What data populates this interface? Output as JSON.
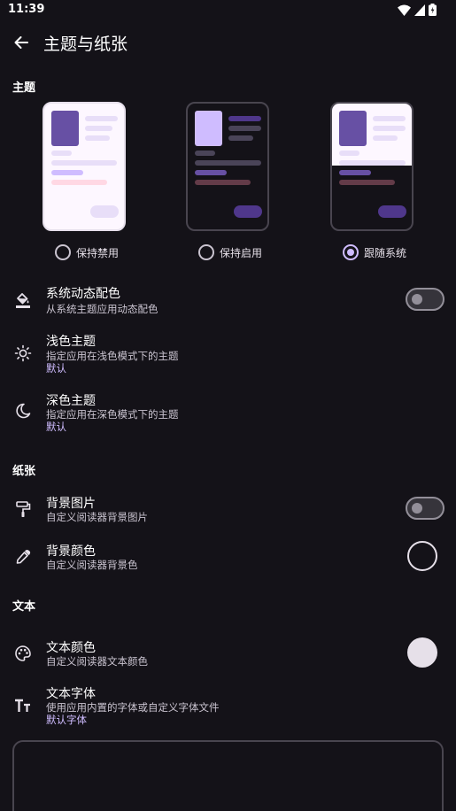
{
  "status": {
    "time": "11:39"
  },
  "header": {
    "title": "主题与纸张"
  },
  "sections": {
    "theme": "主题",
    "paper": "纸张",
    "text": "文本"
  },
  "theme_options": [
    {
      "label": "保持禁用",
      "selected": false
    },
    {
      "label": "保持启用",
      "selected": false
    },
    {
      "label": "跟随系统",
      "selected": true
    }
  ],
  "settings": {
    "dynamic_color": {
      "title": "系统动态配色",
      "subtitle": "从系统主题应用动态配色",
      "enabled": false
    },
    "light_theme": {
      "title": "浅色主题",
      "subtitle": "指定应用在浅色模式下的主题",
      "value": "默认"
    },
    "dark_theme": {
      "title": "深色主题",
      "subtitle": "指定应用在深色模式下的主题",
      "value": "默认"
    },
    "bg_image": {
      "title": "背景图片",
      "subtitle": "自定义阅读器背景图片",
      "enabled": false
    },
    "bg_color": {
      "title": "背景颜色",
      "subtitle": "自定义阅读器背景色",
      "color": "#141218"
    },
    "text_color": {
      "title": "文本颜色",
      "subtitle": "自定义阅读器文本颜色",
      "color": "#e6e0e9"
    },
    "text_font": {
      "title": "文本字体",
      "subtitle": "使用应用内置的字体或自定义字体文件",
      "value": "默认字体"
    }
  },
  "colors": {
    "accent": "#cfbcff",
    "background": "#141218",
    "light_surface": "#fdf7ff",
    "dark_surface": "#141218",
    "primary_block": "#6750a4"
  },
  "icons": {
    "back": "arrow-back-icon",
    "dynamic_color": "format-paint-icon",
    "light_theme": "sun-icon",
    "dark_theme": "moon-icon",
    "bg_image": "paint-roller-icon",
    "bg_color": "eyedropper-icon",
    "text_color": "palette-icon",
    "text_font": "text-fields-icon"
  }
}
